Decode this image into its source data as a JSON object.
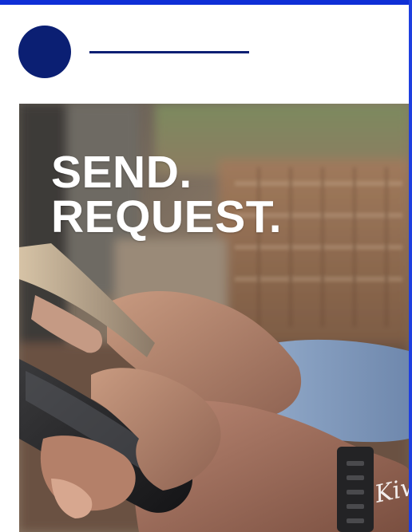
{
  "post": {
    "headline_line1": "SEND.",
    "headline_line2": "REQUEST.",
    "watermark_signature": "Kiwi"
  },
  "colors": {
    "accent_bar": "#0f2fd6",
    "avatar": "#0b1f73",
    "name_placeholder": "#0b1f73",
    "headline_text": "#ffffff"
  },
  "icons": {
    "avatar": "avatar-placeholder-icon"
  }
}
